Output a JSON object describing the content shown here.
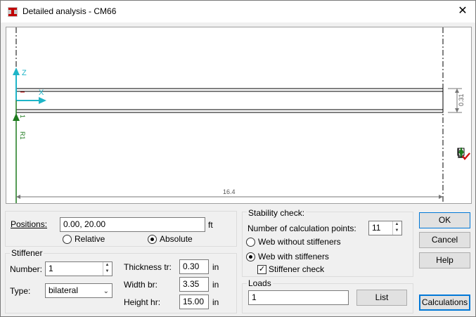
{
  "window": {
    "title": "Detailed analysis - CM66",
    "close_glyph": "✕"
  },
  "canvas": {
    "axis_z": "Z",
    "axis_x": "X",
    "node_label": "1",
    "support_label": "R1",
    "height_dim": "0.31",
    "length_dim": "16.4",
    "colors": {
      "axis": "#1fb5c8",
      "support": "#1e7a1e",
      "check": "#d01010",
      "member": "#000000"
    }
  },
  "positions": {
    "label": "Positions:",
    "value": "0.00, 20.00",
    "unit": "ft",
    "relative_label": "Relative",
    "absolute_label": "Absolute",
    "selected": "absolute"
  },
  "stiffener": {
    "group_label": "Stiffener",
    "number_label": "Number:",
    "number_value": "1",
    "type_label": "Type:",
    "type_value": "bilateral",
    "thickness_label": "Thickness tr:",
    "thickness_value": "0.30",
    "thickness_unit": "in",
    "width_label": "Width br:",
    "width_value": "3.35",
    "width_unit": "in",
    "height_label": "Height hr:",
    "height_value": "15.00",
    "height_unit": "in"
  },
  "stability": {
    "group_label": "Stability check:",
    "points_label": "Number of calculation points:",
    "points_value": "11",
    "web_without_label": "Web without stiffeners",
    "web_with_label": "Web with stiffeners",
    "selected": "web_with",
    "stiffener_check_label": "Stiffener check",
    "stiffener_check_checked": true
  },
  "loads": {
    "group_label": "Loads",
    "value": "1",
    "list_button": "List"
  },
  "buttons": {
    "ok": "OK",
    "cancel": "Cancel",
    "help": "Help",
    "calculations": "Calculations"
  },
  "icons": {
    "app": "section-icon",
    "close": "close-icon",
    "tools": [
      "dimension-check-icon",
      "section-check-icon",
      "load-down-check-icon",
      "load-up-check-icon"
    ]
  }
}
